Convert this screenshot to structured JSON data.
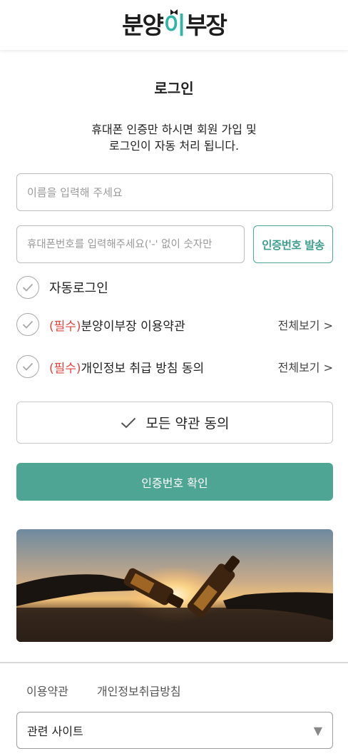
{
  "header": {
    "logo_part1": "분양",
    "logo_part2": "이",
    "logo_part3": "부장"
  },
  "login": {
    "title": "로그인",
    "desc_line1": "휴대폰 인증만 하시면 회원 가입 및",
    "desc_line2": "로그인이 자동 처리 됩니다."
  },
  "form": {
    "name_placeholder": "이름을 입력해 주세요",
    "phone_placeholder": "휴대폰번호를 입력해주세요('-' 없이 숫자만",
    "send_label": "인증번호 발송"
  },
  "options": {
    "auto_login": "자동로그인",
    "terms_required": "(필수)",
    "terms_label": "분양이부장 이용약관",
    "privacy_required": "(필수)",
    "privacy_label": "개인정보 취급 방침 동의",
    "view_all": "전체보기 >"
  },
  "agree_all_label": "모든 약관 동의",
  "confirm_label": "인증번호 확인",
  "footer": {
    "terms_link": "이용약관",
    "privacy_link": "개인정보취급방침",
    "related_label": "관련 사이트",
    "related_arrow": "▼"
  },
  "colors": {
    "accent": "#4fa594",
    "required": "#e0443c"
  }
}
